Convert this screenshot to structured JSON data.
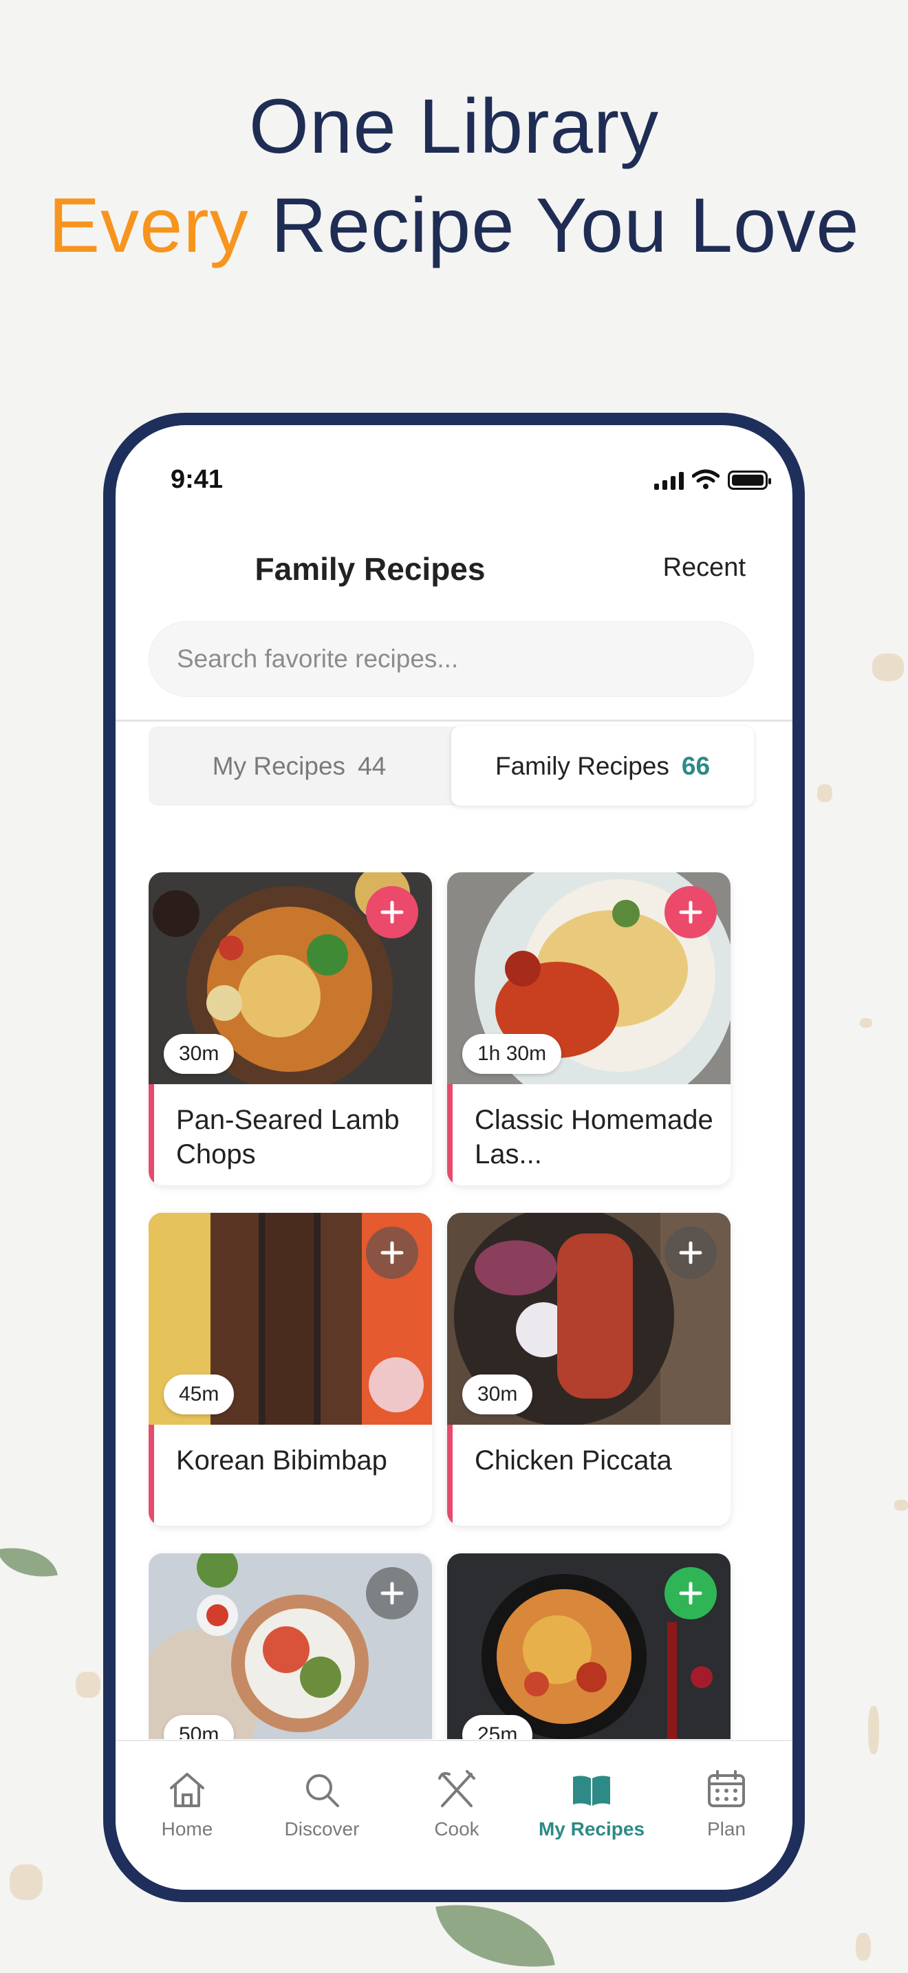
{
  "headline": {
    "line1": "One Library",
    "line2_accent": "Every",
    "line2_rest": " Recipe You Love"
  },
  "colors": {
    "navy": "#1f2d55",
    "orange": "#f7941d",
    "teal": "#2d8a86",
    "pink": "#ec4a6b",
    "green": "#2fb556"
  },
  "status_bar": {
    "time": "9:41"
  },
  "header": {
    "title": "Family Recipes",
    "sort_label": "Recent"
  },
  "search": {
    "placeholder": "Search favorite recipes..."
  },
  "segment": {
    "tabs": [
      {
        "label": "My Recipes",
        "count": "44",
        "active": false
      },
      {
        "label": "Family Recipes",
        "count": "66",
        "active": true
      }
    ]
  },
  "recipes": [
    {
      "name": "Pan-Seared Lamb Chops",
      "time": "30m",
      "add_style": "pink"
    },
    {
      "name": "Classic Homemade Las...",
      "time": "1h 30m",
      "add_style": "pink"
    },
    {
      "name": "Korean Bibimbap",
      "time": "45m",
      "add_style": "grey"
    },
    {
      "name": "Chicken Piccata",
      "time": "30m",
      "add_style": "grey"
    },
    {
      "name": "",
      "time": "50m",
      "add_style": "grey"
    },
    {
      "name": "",
      "time": "25m",
      "add_style": "green"
    }
  ],
  "tabbar": {
    "items": [
      {
        "label": "Home",
        "icon": "home-icon",
        "active": false
      },
      {
        "label": "Discover",
        "icon": "search-icon",
        "active": false
      },
      {
        "label": "Cook",
        "icon": "utensils-icon",
        "active": false
      },
      {
        "label": "My Recipes",
        "icon": "book-icon",
        "active": true
      },
      {
        "label": "Plan",
        "icon": "calendar-icon",
        "active": false
      }
    ]
  }
}
